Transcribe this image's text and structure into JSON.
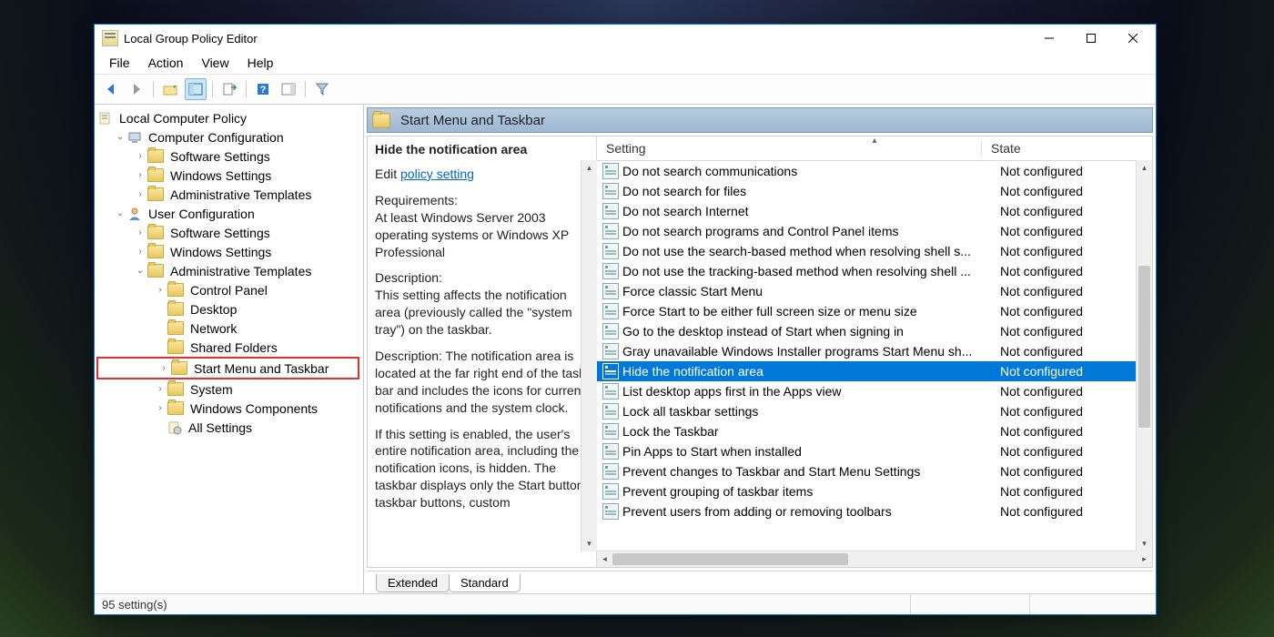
{
  "window": {
    "title": "Local Group Policy Editor"
  },
  "menu": {
    "items": [
      "File",
      "Action",
      "View",
      "Help"
    ]
  },
  "tree": {
    "root": "Local Computer Policy",
    "nodes": [
      {
        "depth": 0,
        "exp": "down",
        "icon": "comp",
        "label": "Computer Configuration"
      },
      {
        "depth": 1,
        "exp": "right",
        "icon": "folder",
        "label": "Software Settings"
      },
      {
        "depth": 1,
        "exp": "right",
        "icon": "folder",
        "label": "Windows Settings"
      },
      {
        "depth": 1,
        "exp": "right",
        "icon": "folder",
        "label": "Administrative Templates"
      },
      {
        "depth": 0,
        "exp": "down",
        "icon": "user",
        "label": "User Configuration"
      },
      {
        "depth": 1,
        "exp": "right",
        "icon": "folder",
        "label": "Software Settings"
      },
      {
        "depth": 1,
        "exp": "right",
        "icon": "folder",
        "label": "Windows Settings"
      },
      {
        "depth": 1,
        "exp": "down",
        "icon": "folder",
        "label": "Administrative Templates"
      },
      {
        "depth": 2,
        "exp": "right",
        "icon": "folder",
        "label": "Control Panel"
      },
      {
        "depth": 2,
        "exp": "none",
        "icon": "folder",
        "label": "Desktop"
      },
      {
        "depth": 2,
        "exp": "none",
        "icon": "folder",
        "label": "Network"
      },
      {
        "depth": 2,
        "exp": "none",
        "icon": "folder",
        "label": "Shared Folders"
      },
      {
        "depth": 2,
        "exp": "right",
        "icon": "folder",
        "label": "Start Menu and Taskbar",
        "boxed": true
      },
      {
        "depth": 2,
        "exp": "right",
        "icon": "folder",
        "label": "System"
      },
      {
        "depth": 2,
        "exp": "right",
        "icon": "folder",
        "label": "Windows Components"
      },
      {
        "depth": 2,
        "exp": "none",
        "icon": "allset",
        "label": "All Settings"
      }
    ]
  },
  "crumb": {
    "label": "Start Menu and Taskbar"
  },
  "info": {
    "heading": "Hide the notification area",
    "edit_prefix": "Edit ",
    "edit_link": "policy setting",
    "req_label": "Requirements:",
    "req_text": "At least Windows Server 2003 operating systems or Windows XP Professional",
    "desc_label": "Description:",
    "desc1": "This setting affects the notification area (previously called the \"system tray\") on the taskbar.",
    "desc2": "Description: The notification area is located at the far right end of the task bar and includes the icons for current notifications and the system clock.",
    "desc3": "If this setting is enabled, the user's entire notification area, including the notification icons, is hidden. The taskbar displays only the Start button, taskbar buttons, custom"
  },
  "list": {
    "columns": {
      "setting": "Setting",
      "state": "State"
    },
    "rows": [
      {
        "s": "Do not search communications",
        "st": "Not configured"
      },
      {
        "s": "Do not search for files",
        "st": "Not configured"
      },
      {
        "s": "Do not search Internet",
        "st": "Not configured"
      },
      {
        "s": "Do not search programs and Control Panel items",
        "st": "Not configured"
      },
      {
        "s": "Do not use the search-based method when resolving shell s...",
        "st": "Not configured"
      },
      {
        "s": "Do not use the tracking-based method when resolving shell ...",
        "st": "Not configured"
      },
      {
        "s": "Force classic Start Menu",
        "st": "Not configured"
      },
      {
        "s": "Force Start to be either full screen size or menu size",
        "st": "Not configured"
      },
      {
        "s": "Go to the desktop instead of Start when signing in",
        "st": "Not configured"
      },
      {
        "s": "Gray unavailable Windows Installer programs Start Menu sh...",
        "st": "Not configured"
      },
      {
        "s": "Hide the notification area",
        "st": "Not configured",
        "sel": true
      },
      {
        "s": "List desktop apps first in the Apps view",
        "st": "Not configured"
      },
      {
        "s": "Lock all taskbar settings",
        "st": "Not configured"
      },
      {
        "s": "Lock the Taskbar",
        "st": "Not configured"
      },
      {
        "s": "Pin Apps to Start when installed",
        "st": "Not configured"
      },
      {
        "s": "Prevent changes to Taskbar and Start Menu Settings",
        "st": "Not configured"
      },
      {
        "s": "Prevent grouping of taskbar items",
        "st": "Not configured"
      },
      {
        "s": "Prevent users from adding or removing toolbars",
        "st": "Not configured"
      }
    ]
  },
  "tabs": {
    "extended": "Extended",
    "standard": "Standard"
  },
  "status": {
    "text": "95 setting(s)"
  }
}
